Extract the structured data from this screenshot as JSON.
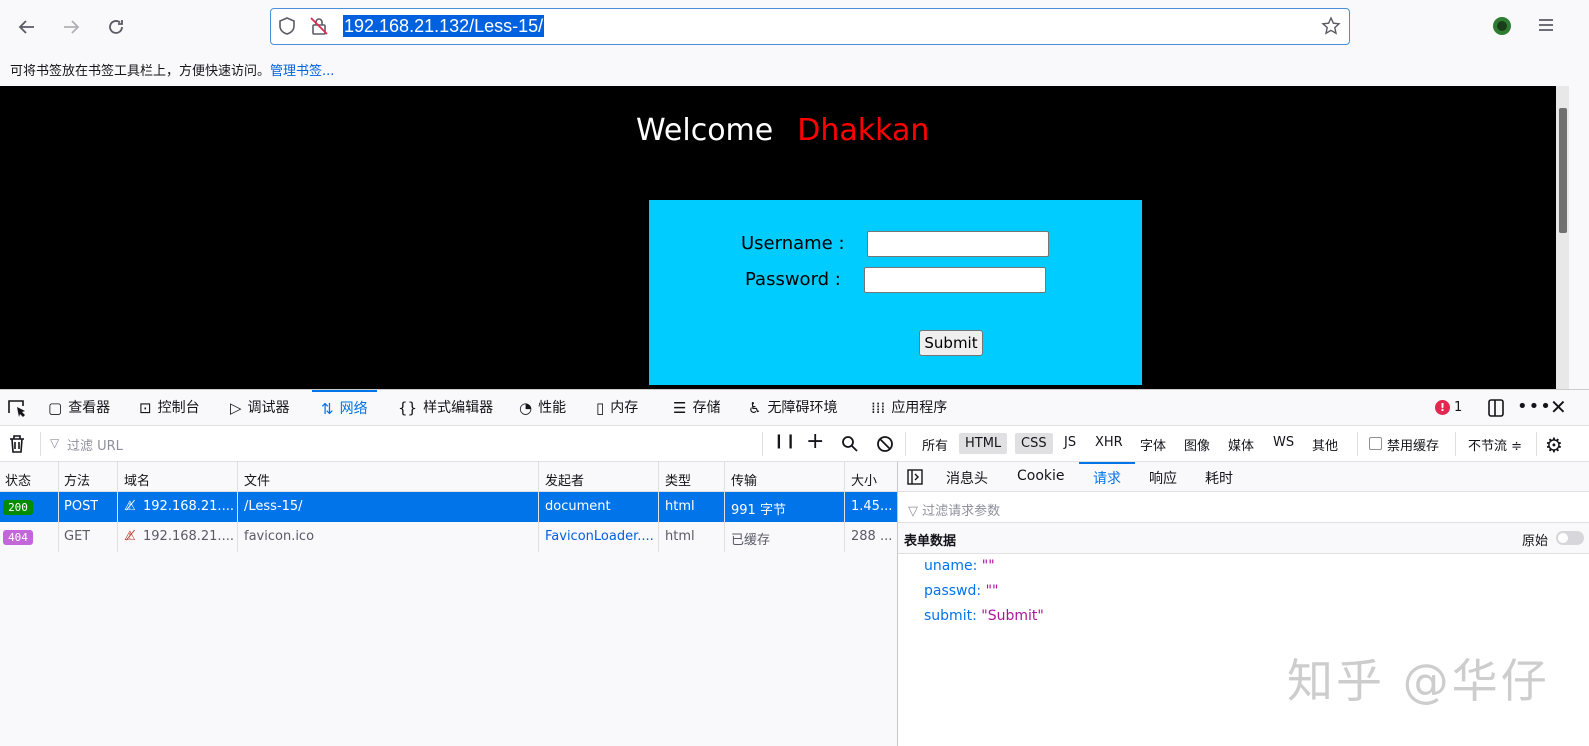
{
  "browser": {
    "url": "192.168.21.132/Less-15/",
    "bookmarks_hint": "可将书签放在书签工具栏上，方便快速访问。",
    "bookmarks_link": "管理书签..."
  },
  "page": {
    "welcome": "Welcome",
    "name": "Dhakkan",
    "username_label": "Username :",
    "password_label": "Password :",
    "submit_label": "Submit"
  },
  "devtools": {
    "tabs": [
      "查看器",
      "控制台",
      "调试器",
      "网络",
      "样式编辑器",
      "性能",
      "内存",
      "存储",
      "无障碍环境",
      "应用程序"
    ],
    "error_count": "1",
    "filter_placeholder": "过滤 URL",
    "type_filters": [
      "所有",
      "HTML",
      "CSS",
      "JS",
      "XHR",
      "字体",
      "图像",
      "媒体",
      "WS",
      "其他"
    ],
    "disable_cache": "禁用缓存",
    "throttle": "不节流 ≑",
    "columns": [
      "状态",
      "方法",
      "域名",
      "文件",
      "发起者",
      "类型",
      "传输",
      "大小"
    ],
    "requests": [
      {
        "status": "200",
        "method": "POST",
        "domain": "192.168.21....",
        "file": "/Less-15/",
        "initiator": "document",
        "type": "html",
        "transfer": "991 字节",
        "size": "1.45..."
      },
      {
        "status": "404",
        "method": "GET",
        "domain": "192.168.21....",
        "file": "favicon.ico",
        "initiator": "FaviconLoader....",
        "type": "html",
        "transfer": "已缓存",
        "size": "288 ..."
      }
    ],
    "detail_tabs": [
      "消息头",
      "Cookie",
      "请求",
      "响应",
      "耗时"
    ],
    "detail_filter_placeholder": "过滤请求参数",
    "form_section": "表单数据",
    "raw_label": "原始",
    "params": [
      {
        "key": "uname:",
        "value": "\"\""
      },
      {
        "key": "passwd:",
        "value": "\"\""
      },
      {
        "key": "submit:",
        "value": "\"Submit\""
      }
    ]
  },
  "watermark": "知乎 @华仔",
  "colors": {
    "status_ok": "#058b00",
    "status_404": "#c466db",
    "accent": "#0074e8"
  }
}
